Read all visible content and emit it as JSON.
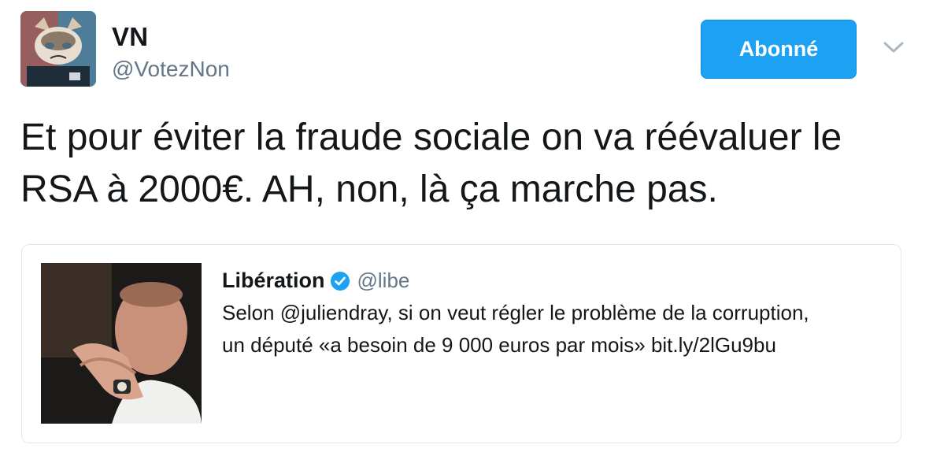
{
  "author": {
    "display_name": "VN",
    "handle": "@VotezNon",
    "avatar_icon": "grumpy-cat-avatar"
  },
  "follow_button": {
    "label": "Abonné"
  },
  "menu": {
    "icon": "chevron-down-icon"
  },
  "tweet": {
    "text_line1": "Et pour éviter la fraude sociale on va réévaluer le",
    "text_line2": "RSA à 2000€. AH, non, là ça marche pas."
  },
  "quoted_tweet": {
    "display_name": "Libération",
    "handle": "@libe",
    "verified_icon": "verified-badge-icon",
    "text_line1": "Selon @juliendray, si on veut régler le problème de la corruption,",
    "text_line2": "un député «a besoin de 9 000 euros par mois» bit.ly/2lGu9bu"
  },
  "colors": {
    "accent": "#1da1f2",
    "text": "#14171a",
    "secondary_text": "#657786",
    "border": "#e1e8ed"
  }
}
